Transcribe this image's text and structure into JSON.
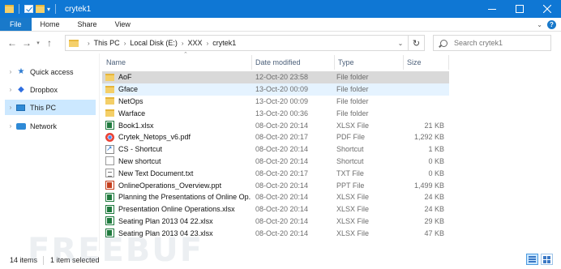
{
  "window": {
    "title": "crytek1",
    "controls": [
      "minimize",
      "maximize",
      "close"
    ]
  },
  "ribbon": {
    "tabs": [
      "File",
      "Home",
      "Share",
      "View"
    ]
  },
  "address": {
    "crumbs": [
      "This PC",
      "Local Disk (E:)",
      "XXX",
      "crytek1"
    ]
  },
  "search": {
    "placeholder": "Search crytek1"
  },
  "nav": {
    "items": [
      {
        "label": "Quick access",
        "icon": "star-icon"
      },
      {
        "label": "Dropbox",
        "icon": "dropbox-icon"
      },
      {
        "label": "This PC",
        "icon": "computer-icon",
        "selected": true
      },
      {
        "label": "Network",
        "icon": "network-icon"
      }
    ]
  },
  "columns": {
    "name": "Name",
    "date": "Date modified",
    "type": "Type",
    "size": "Size"
  },
  "files": [
    {
      "name": "AoF",
      "date": "12-Oct-20 23:58",
      "type": "File folder",
      "size": "",
      "icon": "folder-icon",
      "state": "selected"
    },
    {
      "name": "Gface",
      "date": "13-Oct-20 00:09",
      "type": "File folder",
      "size": "",
      "icon": "folder-icon",
      "state": "hover"
    },
    {
      "name": "NetOps",
      "date": "13-Oct-20 00:09",
      "type": "File folder",
      "size": "",
      "icon": "folder-icon"
    },
    {
      "name": "Warface",
      "date": "13-Oct-20 00:36",
      "type": "File folder",
      "size": "",
      "icon": "folder-icon"
    },
    {
      "name": "Book1.xlsx",
      "date": "08-Oct-20 20:14",
      "type": "XLSX File",
      "size": "21 KB",
      "icon": "excel-icon"
    },
    {
      "name": "Crytek_Netops_v6.pdf",
      "date": "08-Oct-20 20:17",
      "type": "PDF File",
      "size": "1,292 KB",
      "icon": "pdf-icon"
    },
    {
      "name": "CS - Shortcut",
      "date": "08-Oct-20 20:14",
      "type": "Shortcut",
      "size": "1 KB",
      "icon": "shortcut-icon"
    },
    {
      "name": "New shortcut",
      "date": "08-Oct-20 20:14",
      "type": "Shortcut",
      "size": "0 KB",
      "icon": "blank-file-icon"
    },
    {
      "name": "New Text Document.txt",
      "date": "08-Oct-20 20:17",
      "type": "TXT File",
      "size": "0 KB",
      "icon": "text-file-icon"
    },
    {
      "name": "OnlineOperations_Overview.ppt",
      "date": "08-Oct-20 20:14",
      "type": "PPT File",
      "size": "1,499 KB",
      "icon": "powerpoint-icon"
    },
    {
      "name": "Planning the Presentations of Online Op...",
      "date": "08-Oct-20 20:14",
      "type": "XLSX File",
      "size": "24 KB",
      "icon": "excel-icon"
    },
    {
      "name": "Presentation Online Operations.xlsx",
      "date": "08-Oct-20 20:14",
      "type": "XLSX File",
      "size": "24 KB",
      "icon": "excel-icon"
    },
    {
      "name": "Seating Plan 2013 04 22.xlsx",
      "date": "08-Oct-20 20:14",
      "type": "XLSX File",
      "size": "29 KB",
      "icon": "excel-icon"
    },
    {
      "name": "Seating Plan 2013 04 23.xlsx",
      "date": "08-Oct-20 20:14",
      "type": "XLSX File",
      "size": "47 KB",
      "icon": "excel-icon"
    }
  ],
  "status": {
    "count": "14 items",
    "selection": "1 item selected"
  },
  "watermark": "FREEBUF",
  "colors": {
    "titlebar": "#0f77d4",
    "selected_row": "#d9d9d9",
    "hover_row": "#e5f3ff",
    "nav_selected": "#cce8ff"
  }
}
